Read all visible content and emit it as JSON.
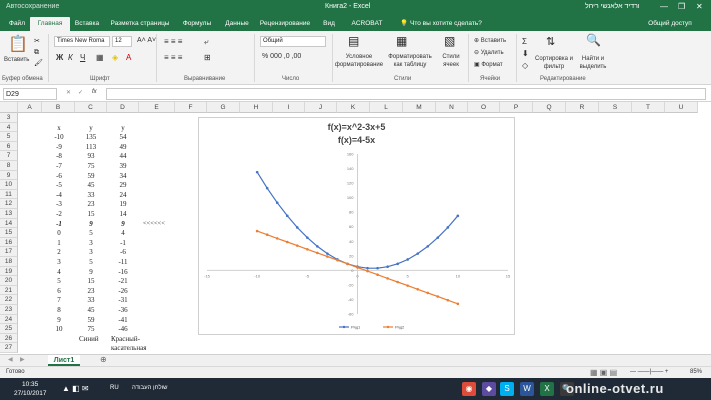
{
  "window": {
    "qat_label": "Автосохранение",
    "title": "Книга2 - Excel",
    "user": "ורדיד אלאנשי ריחל"
  },
  "tabs": [
    {
      "label": "Файл",
      "active": false
    },
    {
      "label": "Главная",
      "active": true
    },
    {
      "label": "Вставка",
      "active": false
    },
    {
      "label": "Разметка страницы",
      "active": false
    },
    {
      "label": "Формулы",
      "active": false
    },
    {
      "label": "Данные",
      "active": false
    },
    {
      "label": "Рецензирование",
      "active": false
    },
    {
      "label": "Вид",
      "active": false
    },
    {
      "label": "ACROBAT",
      "active": false
    }
  ],
  "tell_me": "Что вы хотите сделать?",
  "share": "Общий доступ",
  "ribbon": {
    "paste": "Вставить",
    "clipboard": "Буфер обмена",
    "font_name": "Times New Roma",
    "font_size": "12",
    "font_group": "Шрифт",
    "align_group": "Выравнивание",
    "number_format": "Общий",
    "number_group": "Число",
    "cond_format": "Условное форматирование",
    "format_table": "Форматировать как таблицу",
    "cell_styles": "Стили ячеек",
    "styles_group": "Стили",
    "insert": "Вставить",
    "delete": "Удалить",
    "format": "Формат",
    "cells_group": "Ячейки",
    "sort": "Сортировка и фильтр",
    "find": "Найти и выделить",
    "edit_group": "Редактирование"
  },
  "namebox": "D29",
  "fx": "fx",
  "columns": [
    "A",
    "B",
    "C",
    "D",
    "E",
    "F",
    "G",
    "H",
    "I",
    "J",
    "K",
    "L",
    "M",
    "N",
    "O",
    "P",
    "Q",
    "R",
    "S",
    "T",
    "U"
  ],
  "rows": [
    "3",
    "4",
    "5",
    "6",
    "7",
    "8",
    "9",
    "10",
    "11",
    "12",
    "13",
    "14",
    "15",
    "16",
    "17",
    "18",
    "19",
    "20",
    "21",
    "22",
    "23",
    "24",
    "25",
    "26",
    "27"
  ],
  "table": {
    "x": [
      "x",
      "-10",
      "-9",
      "-8",
      "-7",
      "-6",
      "-5",
      "-4",
      "-3",
      "-2",
      "-1",
      "0",
      "1",
      "2",
      "3",
      "4",
      "5",
      "6",
      "7",
      "8",
      "9",
      "10"
    ],
    "y": [
      "y",
      "135",
      "113",
      "93",
      "75",
      "59",
      "45",
      "33",
      "23",
      "15",
      "9",
      "5",
      "3",
      "3",
      "5",
      "9",
      "15",
      "23",
      "33",
      "45",
      "59",
      "75"
    ],
    "z": [
      "y",
      "54",
      "49",
      "44",
      "39",
      "34",
      "29",
      "24",
      "19",
      "14",
      "9",
      "4",
      "-1",
      "-6",
      "-11",
      "-16",
      "-21",
      "-26",
      "-31",
      "-36",
      "-41",
      "-46"
    ],
    "arrow": "<<<<<<",
    "blue_label": "Синий",
    "red_label": "Красный-",
    "red_label2": "касательная"
  },
  "chart_data": {
    "type": "line",
    "title": "f(x)=x^2-3x+5",
    "subtitle": "f(x)=4-5x",
    "x": [
      -10,
      -9,
      -8,
      -7,
      -6,
      -5,
      -4,
      -3,
      -2,
      -1,
      0,
      1,
      2,
      3,
      4,
      5,
      6,
      7,
      8,
      9,
      10
    ],
    "series": [
      {
        "name": "Ряд1",
        "color": "#4472c4",
        "values": [
          135,
          113,
          93,
          75,
          59,
          45,
          33,
          23,
          15,
          9,
          5,
          3,
          3,
          5,
          9,
          15,
          23,
          33,
          45,
          59,
          75
        ]
      },
      {
        "name": "Ряд2",
        "color": "#ed7d31",
        "values": [
          54,
          49,
          44,
          39,
          34,
          29,
          24,
          19,
          14,
          9,
          4,
          -1,
          -6,
          -11,
          -16,
          -21,
          -26,
          -31,
          -36,
          -41,
          -46
        ]
      }
    ],
    "xticks": [
      "-15",
      "-10",
      "-5",
      "0",
      "5",
      "10",
      "15"
    ],
    "yticks": [
      "160",
      "140",
      "120",
      "100",
      "80",
      "60",
      "40",
      "20",
      "0",
      "-20",
      "-40",
      "-60"
    ],
    "xlim": [
      -15,
      15
    ],
    "ylim": [
      -60,
      160
    ],
    "legend": "bottom",
    "grid": false
  },
  "sheet_tab": "Лист1",
  "status": {
    "ready": "Готово",
    "zoom": "85%"
  },
  "taskbar": {
    "time": "10:35",
    "date": "27/10/2017",
    "lang": "RU",
    "lang2": "שולחן העבודה"
  },
  "watermark": "online-otvet.ru"
}
